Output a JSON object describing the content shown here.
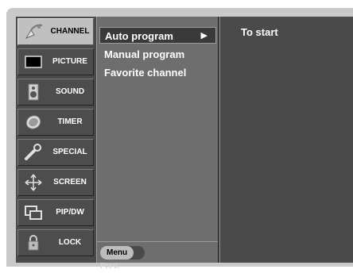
{
  "categories": [
    {
      "label": "CHANNEL",
      "icon": "satellite-dish-icon",
      "active": true
    },
    {
      "label": "PICTURE",
      "icon": "tv-screen-icon"
    },
    {
      "label": "SOUND",
      "icon": "speaker-icon"
    },
    {
      "label": "TIMER",
      "icon": "clock-icon"
    },
    {
      "label": "SPECIAL",
      "icon": "tools-icon"
    },
    {
      "label": "SCREEN",
      "icon": "move-arrows-icon"
    },
    {
      "label": "PIP/DW",
      "icon": "pip-windows-icon"
    },
    {
      "label": "LOCK",
      "icon": "padlock-icon"
    }
  ],
  "submenu": {
    "items": [
      {
        "label": "Auto program",
        "arrow": "▶",
        "selected": true
      },
      {
        "label": "Manual program"
      },
      {
        "label": "Favorite channel"
      }
    ],
    "footer": {
      "menu_label": "Menu",
      "prev_label": "Prev."
    }
  },
  "detail": {
    "text": "To start"
  }
}
